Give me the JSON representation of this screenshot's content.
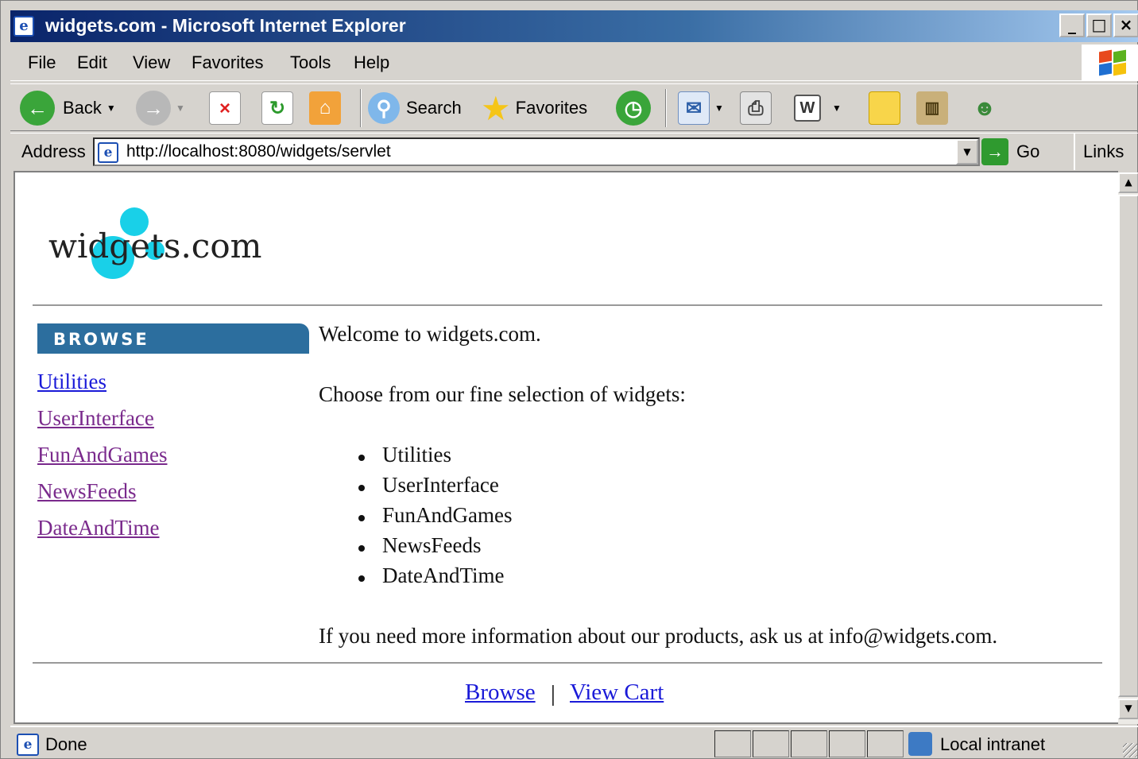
{
  "window": {
    "title": "widgets.com - Microsoft Internet Explorer",
    "buttons": {
      "minimize": "_",
      "maximize": "□",
      "close": "×"
    }
  },
  "menu": [
    "File",
    "Edit",
    "View",
    "Favorites",
    "Tools",
    "Help"
  ],
  "toolbar": {
    "back_label": "Back",
    "search_label": "Search",
    "favorites_label": "Favorites"
  },
  "address": {
    "label": "Address",
    "url": "http://localhost:8080/widgets/servlet",
    "go_label": "Go",
    "links_label": "Links",
    "chevron": "»"
  },
  "page": {
    "logo_text": "widgets.com",
    "browse_header": "BROWSE",
    "sidebar_links": [
      "Utilities",
      "UserInterface",
      "FunAndGames",
      "NewsFeeds",
      "DateAndTime"
    ],
    "welcome": "Welcome to widgets.com.",
    "choose": "Choose from our fine selection of widgets:",
    "categories": [
      "Utilities",
      "UserInterface",
      "FunAndGames",
      "NewsFeeds",
      "DateAndTime"
    ],
    "info": "If you need more information about our products, ask us at info@widgets.com.",
    "footer": {
      "browse": "Browse",
      "separator": "|",
      "view_cart": "View Cart"
    }
  },
  "status": {
    "text": "Done",
    "zone": "Local intranet"
  },
  "colors": {
    "titlebar_start": "#0a246a",
    "browse_header": "#2c6e9e",
    "visited_link": "#7a2a8c",
    "link": "#1a1ad8",
    "logo_dots": "#19d0e8"
  }
}
